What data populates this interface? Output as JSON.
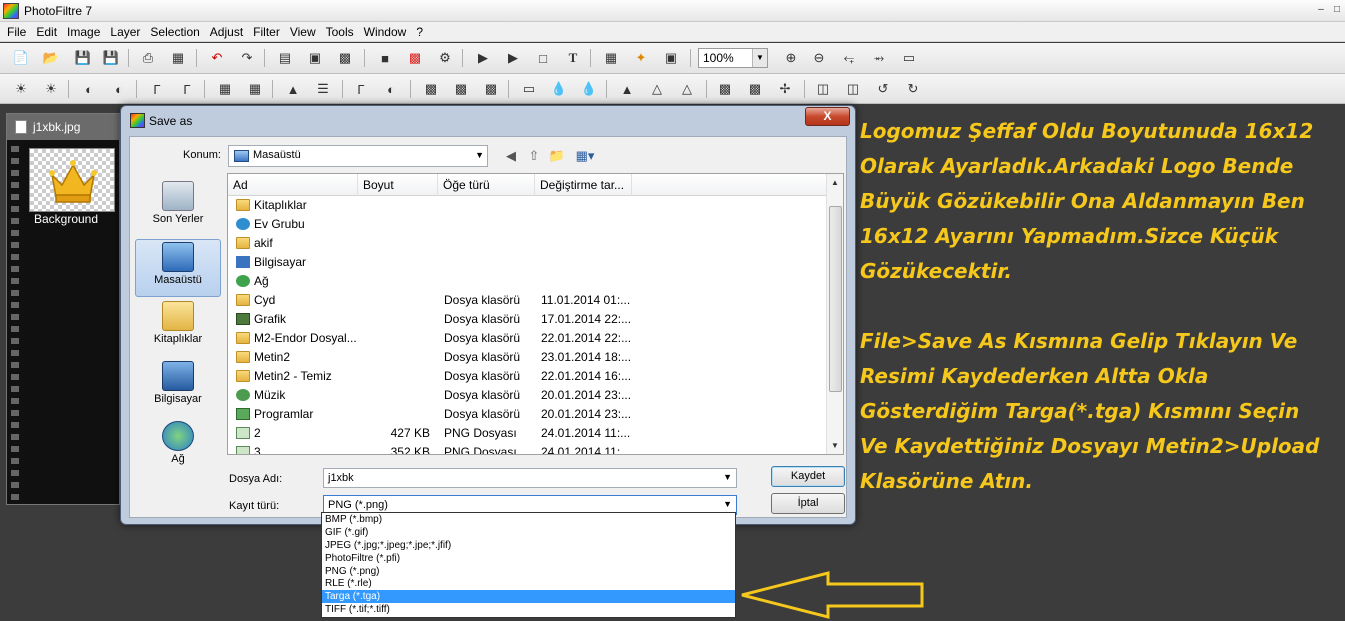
{
  "app": {
    "title": "PhotoFiltre 7"
  },
  "menu": [
    "File",
    "Edit",
    "Image",
    "Layer",
    "Selection",
    "Adjust",
    "Filter",
    "View",
    "Tools",
    "Window",
    "?"
  ],
  "toolbar": {
    "zoom": "100%"
  },
  "document": {
    "title": "j1xbk.jpg",
    "layer_label": "Background"
  },
  "dialog": {
    "title": "Save as",
    "close_label": "X",
    "location_label": "Konum:",
    "location_value": "Masaüstü",
    "places": [
      "Son Yerler",
      "Masaüstü",
      "Kitaplıklar",
      "Bilgisayar",
      "Ağ"
    ],
    "columns": [
      "Ad",
      "Boyut",
      "Öğe türü",
      "Değiştirme tar..."
    ],
    "files": [
      {
        "name": "Kitaplıklar",
        "size": "",
        "type": "",
        "date": ""
      },
      {
        "name": "Ev Grubu",
        "size": "",
        "type": "",
        "date": ""
      },
      {
        "name": "akif",
        "size": "",
        "type": "",
        "date": ""
      },
      {
        "name": "Bilgisayar",
        "size": "",
        "type": "",
        "date": ""
      },
      {
        "name": "Ağ",
        "size": "",
        "type": "",
        "date": ""
      },
      {
        "name": "Cyd",
        "size": "",
        "type": "Dosya klasörü",
        "date": "11.01.2014 01:..."
      },
      {
        "name": "Grafik",
        "size": "",
        "type": "Dosya klasörü",
        "date": "17.01.2014 22:..."
      },
      {
        "name": "M2-Endor Dosyal...",
        "size": "",
        "type": "Dosya klasörü",
        "date": "22.01.2014 22:..."
      },
      {
        "name": "Metin2",
        "size": "",
        "type": "Dosya klasörü",
        "date": "23.01.2014 18:..."
      },
      {
        "name": "Metin2 - Temiz",
        "size": "",
        "type": "Dosya klasörü",
        "date": "22.01.2014 16:..."
      },
      {
        "name": "Müzik",
        "size": "",
        "type": "Dosya klasörü",
        "date": "20.01.2014 23:..."
      },
      {
        "name": "Programlar",
        "size": "",
        "type": "Dosya klasörü",
        "date": "20.01.2014 23:..."
      },
      {
        "name": "2",
        "size": "427 KB",
        "type": "PNG Dosyası",
        "date": "24.01.2014 11:..."
      },
      {
        "name": "3",
        "size": "352 KB",
        "type": "PNG Dosyası",
        "date": "24.01.2014 11:..."
      }
    ],
    "filename_label": "Dosya Adı:",
    "filename_value": "j1xbk",
    "filetype_label": "Kayıt türü:",
    "filetype_value": "PNG (*.png)",
    "save_label": "Kaydet",
    "cancel_label": "İptal"
  },
  "filetype_options": [
    "BMP (*.bmp)",
    "GIF (*.gif)",
    "JPEG (*.jpg;*.jpeg;*.jpe;*.jfif)",
    "PhotoFiltre (*.pfi)",
    "PNG (*.png)",
    "RLE (*.rle)",
    "Targa (*.tga)",
    "TIFF (*.tif;*.tiff)"
  ],
  "filetype_selected": "Targa (*.tga)",
  "annotation": {
    "para1": [
      "Logomuz Şeffaf Oldu Boyutunuda 16x12",
      "Olarak Ayarladık.Arkadaki Logo Bende",
      "Büyük Gözükebilir Ona Aldanmayın Ben",
      "16x12 Ayarını Yapmadım.Sizce Küçük",
      "Gözükecektir."
    ],
    "para2": [
      "File>Save As Kısmına Gelip Tıklayın Ve",
      "Resimi Kaydederken Altta Okla",
      "Gösterdiğim Targa(*.tga) Kısmını Seçin",
      "Ve Kaydettiğiniz Dosyayı Metin2>Upload",
      "Klasörüne Atın."
    ]
  },
  "colors": {
    "annotation": "#f6c81c",
    "highlight": "#3399ff",
    "arrow": "#f6c81c"
  }
}
